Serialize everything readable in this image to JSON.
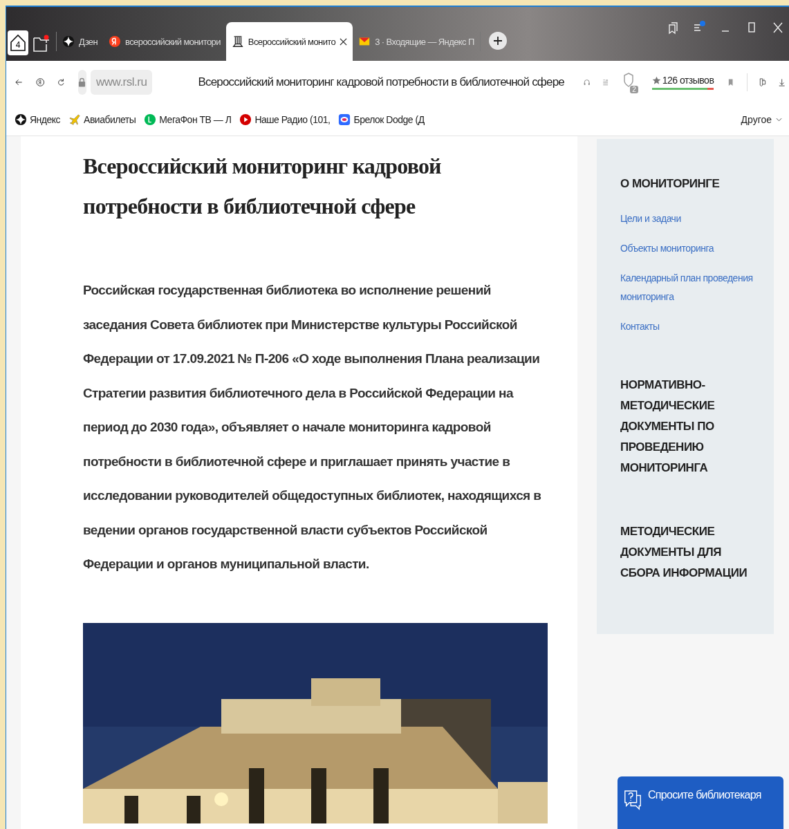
{
  "home": {
    "badge": "4"
  },
  "tabs": [
    {
      "kind": "zen",
      "title": "Дзен",
      "selected": false
    },
    {
      "kind": "yandex",
      "title": "всероссийский монитори",
      "selected": false
    },
    {
      "kind": "library",
      "title": "Всероссийский монито",
      "selected": true
    },
    {
      "kind": "mail",
      "title": "3 · Входящие — Яндекс П",
      "selected": false
    }
  ],
  "address_bar": {
    "url": "www.rsl.ru",
    "page_title": "Всероссийский мониторинг кадровой потребности в библиотечной сфере",
    "protect_badge": "2",
    "reviews": {
      "label": "126 отзывов",
      "level": 0.9
    }
  },
  "bookmarks": [
    {
      "kind": "zen",
      "label": "Яндекс"
    },
    {
      "kind": "plane",
      "label": "Авиабилеты"
    },
    {
      "kind": "megafon",
      "label": "МегаФон ТВ — Л"
    },
    {
      "kind": "play",
      "label": "Наше Радио (101,"
    },
    {
      "kind": "ring",
      "label": "Брелок Dodge (Д"
    }
  ],
  "bookmarks_more": "Другое",
  "article": {
    "title": "Всероссийский мониторинг кадровой потребности в библиотечной сфере",
    "text": "Российская государственная библиотека во исполнение решений заседания Совета библиотек при Министерстве культуры Российской Федерации от 17.09.2021 № П-206 «О ходе выполнения Плана реализации Стратегии развития библиотечного дела в Российской Федерации на период до 2030 года», объявляет о начале мониторинга кадровой потребности в библиотечной сфере и приглашает принять участие в исследовании руководителей общедоступных библиотек, находящихся в ведении органов государственной власти субъектов Российской Федерации и органов муниципальной власти."
  },
  "sidebar": [
    {
      "heading": "О МОНИТОРИНГЕ",
      "links": [
        "Цели и задачи",
        "Объекты мониторинга",
        "Календарный план проведения мониторинга",
        "Контакты"
      ]
    },
    {
      "heading": "НОРМАТИВНО-МЕТОДИЧЕСКИЕ ДОКУМЕНТЫ ПО ПРОВЕДЕНИЮ МОНИТОРИНГА"
    },
    {
      "heading": "МЕТОДИЧЕСКИЕ ДОКУМЕНТЫ ДЛЯ СБОРА ИНФОРМАЦИИ"
    }
  ],
  "chat_button": "Спросите библиотекаря"
}
